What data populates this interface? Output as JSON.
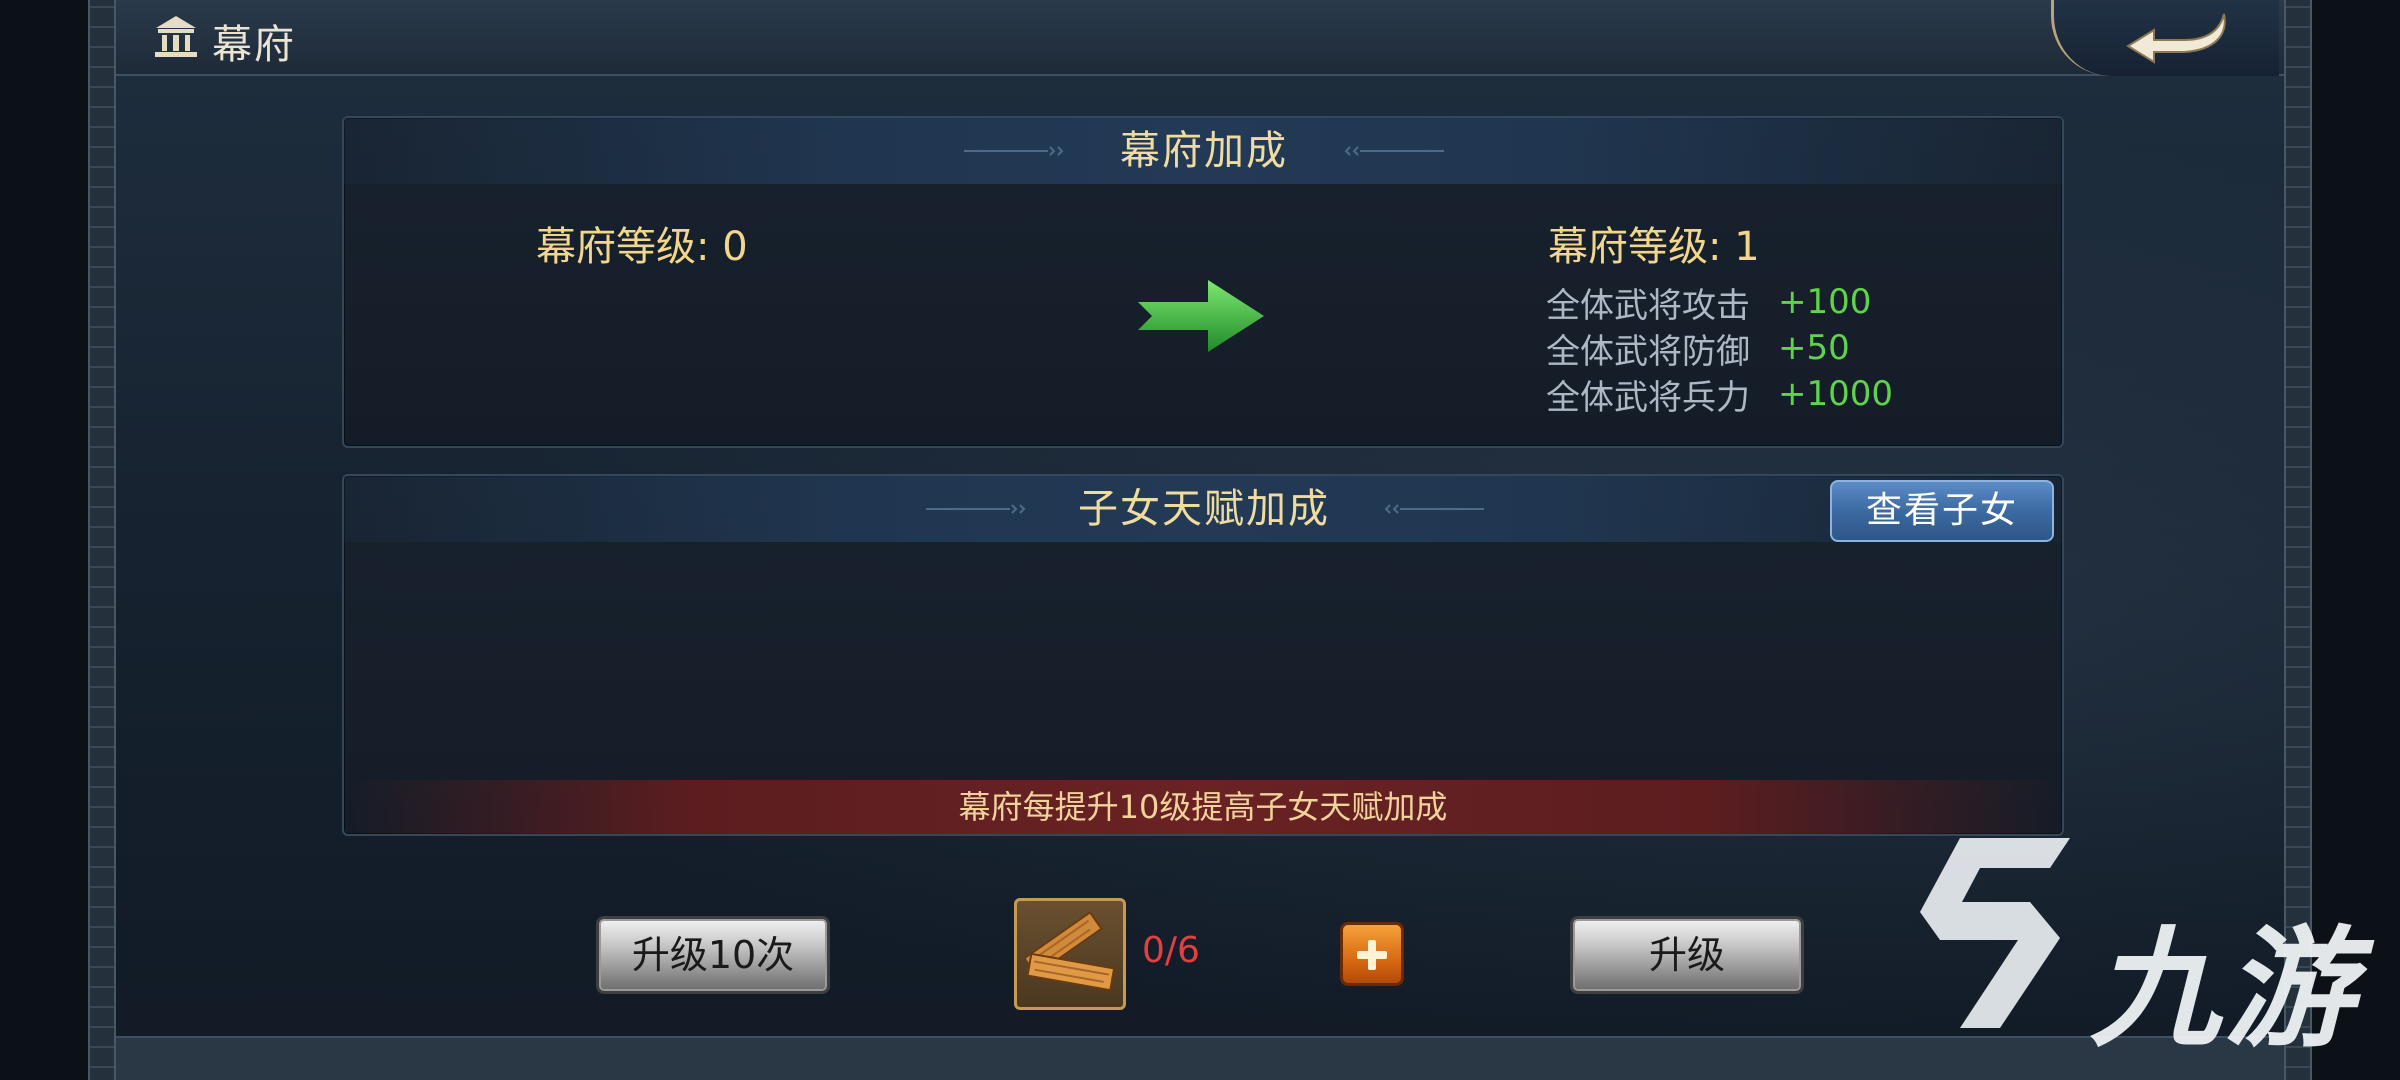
{
  "header": {
    "title": "幕府",
    "title_icon": "mansion-icon",
    "back_icon": "back-arrow-icon"
  },
  "bonus_panel": {
    "title": "幕府加成",
    "current_level": "幕府等级: 0",
    "next_level": "幕府等级: 1",
    "arrow_icon": "green-arrow-right-icon",
    "stats": [
      {
        "name": "全体武将攻击",
        "value": "+100"
      },
      {
        "name": "全体武将防御",
        "value": "+50"
      },
      {
        "name": "全体武将兵力",
        "value": "+1000"
      }
    ]
  },
  "talent_panel": {
    "title": "子女天赋加成",
    "view_button": "查看子女",
    "hint": "幕府每提升10级提高子女天赋加成"
  },
  "controls": {
    "upgrade_ten_label": "升级10次",
    "upgrade_label": "升级",
    "material_icon": "wood-planks-icon",
    "material_count": "0/6",
    "add_icon": "plus-icon"
  },
  "watermark": {
    "text": "九游",
    "logo_icon": "jiuyou-logo-icon"
  },
  "colors": {
    "title_gold": "#f0dca0",
    "level_gold": "#f2d68c",
    "stat_green": "#5fd34a",
    "stat_grey": "#aeb8c4",
    "count_red": "#e04040",
    "hint_bar": "#6a2224",
    "button_blue": "#3c6aa2"
  }
}
